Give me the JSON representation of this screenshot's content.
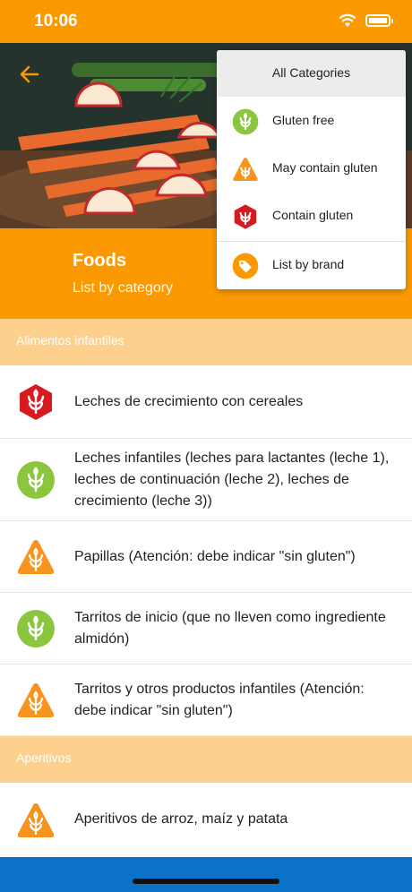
{
  "status": {
    "time": "10:06"
  },
  "header": {
    "title": "Foods",
    "subtitle": "List by category"
  },
  "dropdown": {
    "title": "All Categories",
    "items": [
      {
        "label": "Gluten free",
        "icon": "gluten-free-icon"
      },
      {
        "label": "May contain gluten",
        "icon": "may-contain-gluten-icon"
      },
      {
        "label": "Contain gluten",
        "icon": "contain-gluten-icon"
      },
      {
        "label": "List by brand",
        "icon": "tag-icon"
      }
    ]
  },
  "sections": [
    {
      "title": "Alimentos infantiles",
      "items": [
        {
          "label": "Leches de crecimiento con cereales",
          "status": "contain-gluten"
        },
        {
          "label": "Leches infantiles (leches para lactantes (leche 1), leches de continuación (leche 2), leches de crecimiento (leche 3))",
          "status": "gluten-free"
        },
        {
          "label": "Papillas (Atención: debe indicar \"sin gluten\")",
          "status": "may-contain-gluten"
        },
        {
          "label": "Tarritos de inicio (que no lleven como ingrediente almidón)",
          "status": "gluten-free"
        },
        {
          "label": "Tarritos y otros productos infantiles (Atención: debe indicar \"sin gluten\")",
          "status": "may-contain-gluten"
        }
      ]
    },
    {
      "title": "Aperitivos",
      "items": [
        {
          "label": "Aperitivos de arroz, maíz y patata",
          "status": "may-contain-gluten"
        }
      ]
    }
  ],
  "colors": {
    "primary": "#fb9a00",
    "section_bg": "#fdd08d",
    "gluten_free": "#8cc63f",
    "may_contain": "#f7941d",
    "contain": "#d71920",
    "bottom_bar": "#0a72c8"
  }
}
